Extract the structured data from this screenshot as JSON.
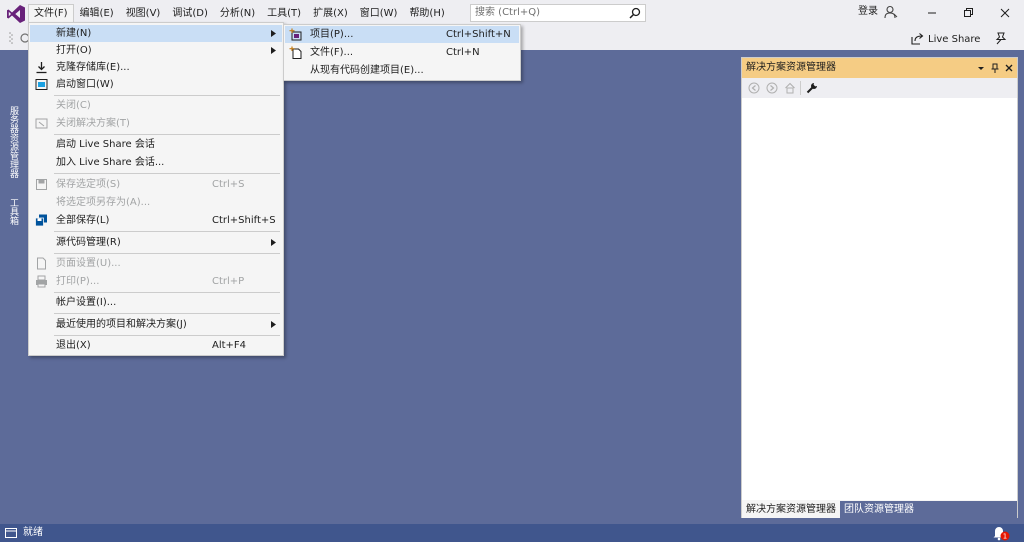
{
  "menubar": {
    "items": [
      "文件(F)",
      "编辑(E)",
      "视图(V)",
      "调试(D)",
      "分析(N)",
      "工具(T)",
      "扩展(X)",
      "窗口(W)",
      "帮助(H)"
    ],
    "search_placeholder": "搜索 (Ctrl+Q)",
    "login": "登录"
  },
  "toolbar": {
    "live_share": "Live Share"
  },
  "left_tabs": {
    "server_explorer": "服务器资源管理器",
    "toolbox": "工具箱"
  },
  "file_menu": {
    "items": [
      {
        "label": "新建(N)",
        "shortcut": "",
        "submenu": true,
        "icon": "blank",
        "state": "highlighted"
      },
      {
        "label": "打开(O)",
        "shortcut": "",
        "submenu": true,
        "icon": "blank",
        "state": "enabled"
      },
      {
        "label": "克隆存储库(E)...",
        "shortcut": "",
        "submenu": false,
        "icon": "clone-download-icon",
        "state": "enabled"
      },
      {
        "label": "启动窗口(W)",
        "shortcut": "",
        "submenu": false,
        "icon": "start-window-icon",
        "state": "enabled"
      },
      {
        "label": "关闭(C)",
        "shortcut": "",
        "submenu": false,
        "icon": "blank",
        "state": "disabled"
      },
      {
        "label": "关闭解决方案(T)",
        "shortcut": "",
        "submenu": false,
        "icon": "close-solution-icon",
        "state": "disabled"
      },
      {
        "label": "启动 Live Share 会话",
        "shortcut": "",
        "submenu": false,
        "icon": "blank",
        "state": "enabled"
      },
      {
        "label": "加入 Live Share 会话...",
        "shortcut": "",
        "submenu": false,
        "icon": "blank",
        "state": "enabled"
      },
      {
        "label": "保存选定项(S)",
        "shortcut": "Ctrl+S",
        "submenu": false,
        "icon": "save-icon",
        "state": "disabled"
      },
      {
        "label": "将选定项另存为(A)...",
        "shortcut": "",
        "submenu": false,
        "icon": "blank",
        "state": "disabled"
      },
      {
        "label": "全部保存(L)",
        "shortcut": "Ctrl+Shift+S",
        "submenu": false,
        "icon": "save-all-icon",
        "state": "enabled"
      },
      {
        "label": "源代码管理(R)",
        "shortcut": "",
        "submenu": true,
        "icon": "blank",
        "state": "enabled"
      },
      {
        "label": "页面设置(U)...",
        "shortcut": "",
        "submenu": false,
        "icon": "page-setup-icon",
        "state": "disabled"
      },
      {
        "label": "打印(P)...",
        "shortcut": "Ctrl+P",
        "submenu": false,
        "icon": "print-icon",
        "state": "disabled"
      },
      {
        "label": "帐户设置(I)...",
        "shortcut": "",
        "submenu": false,
        "icon": "blank",
        "state": "enabled"
      },
      {
        "label": "最近使用的项目和解决方案(J)",
        "shortcut": "",
        "submenu": true,
        "icon": "blank",
        "state": "enabled"
      },
      {
        "label": "退出(X)",
        "shortcut": "Alt+F4",
        "submenu": false,
        "icon": "blank",
        "state": "enabled"
      }
    ]
  },
  "new_submenu": {
    "items": [
      {
        "label": "项目(P)...",
        "shortcut": "Ctrl+Shift+N",
        "icon": "new-project-icon",
        "state": "highlighted"
      },
      {
        "label": "文件(F)...",
        "shortcut": "Ctrl+N",
        "icon": "new-file-icon",
        "state": "enabled"
      },
      {
        "label": "从现有代码创建项目(E)...",
        "shortcut": "",
        "icon": "blank",
        "state": "enabled"
      }
    ]
  },
  "solution_explorer": {
    "title": "解决方案资源管理器",
    "bottom_tabs": [
      "解决方案资源管理器",
      "团队资源管理器"
    ]
  },
  "statusbar": {
    "text": "就绪",
    "notification_count": "1"
  },
  "colors": {
    "accent": "#68217a",
    "workspace": "#5d6b99",
    "statusbar": "#40568d",
    "active_tool_header": "#f5cc84",
    "menu_highlight": "#c9def5"
  }
}
